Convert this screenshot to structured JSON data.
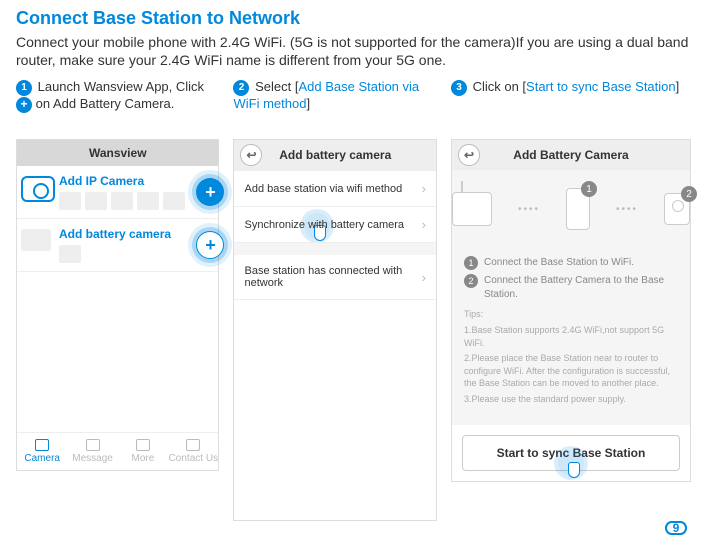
{
  "title": "Connect Base Station to Network",
  "intro": "Connect your mobile phone with 2.4G WiFi. (5G is not supported for the camera)If you are using a dual band router, make sure your 2.4G WiFi name is different from your 5G one.",
  "steps": {
    "s1": {
      "num": "1",
      "pre": " Launch Wansview App, Click ",
      "post": "on Add Battery Camera."
    },
    "s2": {
      "num": "2",
      "pre": " Select [",
      "link": "Add Base Station via WiFi method",
      "post": "]"
    },
    "s3": {
      "num": "3",
      "pre": " Click on [",
      "link": "Start to sync Base Station",
      "post": "]"
    }
  },
  "screen1": {
    "title": "Wansview",
    "ip_label": "Add IP Camera",
    "batt_label": "Add battery camera",
    "tabs": {
      "camera": "Camera",
      "message": "Message",
      "more": "More",
      "contact": "Contact Us"
    }
  },
  "screen2": {
    "title": "Add battery camera",
    "row1": "Add base station via wifi method",
    "row2": "Synchronize with battery camera",
    "row3": "Base station has connected with network"
  },
  "screen3": {
    "title": "Add Battery Camera",
    "badge1": "1",
    "badge2": "2",
    "note1": "Connect the Base Station to WiFi.",
    "note2": "Connect the Battery Camera to the Base Station.",
    "tips_label": "Tips:",
    "tip1": "1.Base Station supports 2.4G WiFi,not support 5G WiFi.",
    "tip2": "2.Please place the Base Station near to router to configure WiFi. After the configuration is successful, the Base Station can be moved to another place.",
    "tip3": "3.Please use the standard power supply.",
    "sync_btn": "Start to sync Base Station"
  },
  "page_number": "9"
}
